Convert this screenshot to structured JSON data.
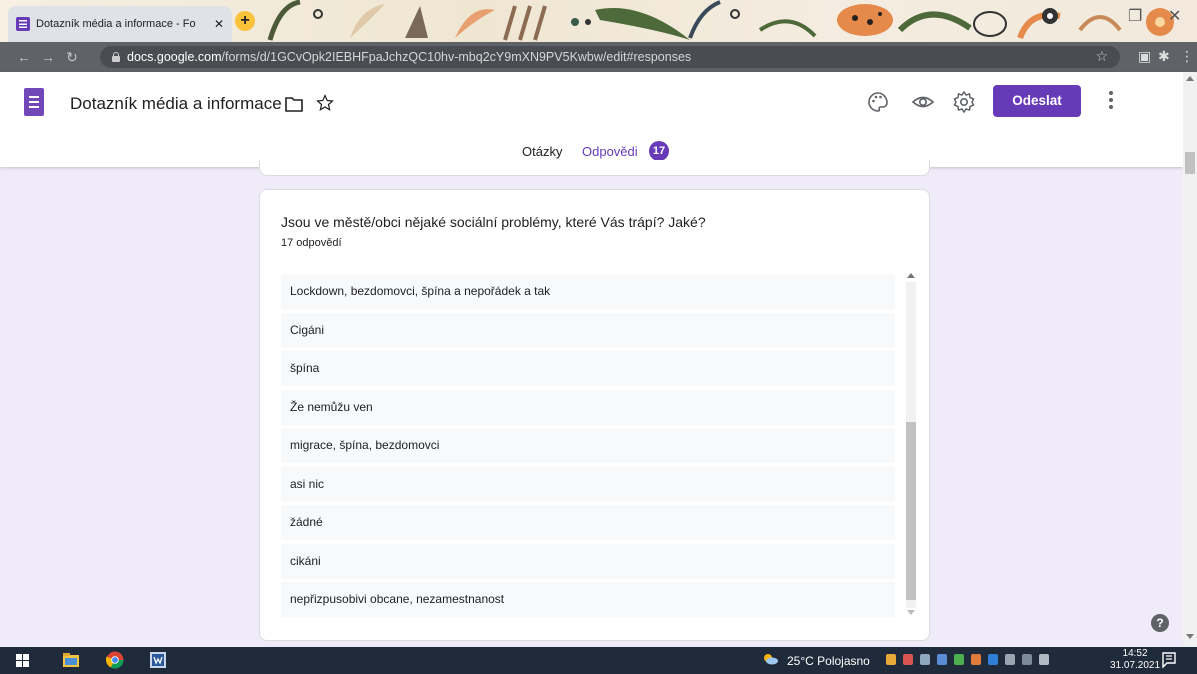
{
  "browser": {
    "tab_title": "Dotazník média a informace - Fo",
    "tab_close": "✕",
    "new_tab": "+",
    "url_host": "docs.google.com",
    "url_path": "/forms/d/1GCvOpk2IEBHFpaJchzQC10hv-mbq2cY9mXN9PV5Kwbw/edit#responses"
  },
  "header": {
    "form_title": "Dotazník média a informace",
    "send_label": "Odeslat",
    "tabs": [
      {
        "label": "Otázky"
      },
      {
        "label": "Odpovědi"
      }
    ],
    "response_badge": "17"
  },
  "card": {
    "question": "Jsou ve městě/obci nějaké sociální problémy, které Vás trápí? Jaké?",
    "response_count": "17 odpovědí",
    "responses": [
      "Lockdown, bezdomovci, špína a nepořádek a tak",
      "Cigáni",
      "špína",
      "Že nemůžu ven",
      "migrace, špína, bezdomovci",
      "asi nic",
      "žádné",
      "cikáni",
      "nepřizpusobivi obcane, nezamestnanost"
    ]
  },
  "help": {
    "label": "?"
  },
  "taskbar": {
    "weather": "25°C Polojasno",
    "time": "14:52",
    "date": "31.07.2021"
  },
  "colors": {
    "accent": "#673ab7",
    "background": "#f0ebf8",
    "taskbar": "#1f2a3a"
  }
}
